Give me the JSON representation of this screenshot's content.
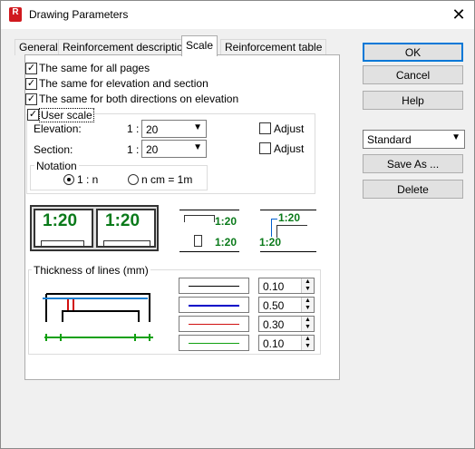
{
  "window": {
    "title": "Drawing Parameters",
    "app_icon_letter": "R"
  },
  "tabs": [
    "General",
    "Reinforcement description",
    "Scale",
    "Reinforcement table"
  ],
  "options": {
    "same_all_pages": "The same for all pages",
    "same_elev_section": "The same for elevation and section",
    "same_both_dirs": "The same for both directions on elevation",
    "user_scale": "User scale"
  },
  "scale": {
    "elevation_label": "Elevation:",
    "section_label": "Section:",
    "prefix": "1 :",
    "elevation_value": "20",
    "section_value": "20",
    "adjust_label": "Adjust"
  },
  "notation": {
    "label": "Notation",
    "opt1": "1 : n",
    "opt2": "n cm = 1m"
  },
  "previews": {
    "scale_text": "1:20"
  },
  "thickness": {
    "label": "Thickness of lines (mm)",
    "values": [
      "0.10",
      "0.50",
      "0.30",
      "0.10"
    ]
  },
  "line_colors": [
    "#000000",
    "#0000c8",
    "#d01010",
    "#10a010"
  ],
  "buttons": {
    "ok": "OK",
    "cancel": "Cancel",
    "help": "Help",
    "save_as": "Save As ...",
    "delete": "Delete"
  },
  "preset": {
    "value": "Standard"
  }
}
